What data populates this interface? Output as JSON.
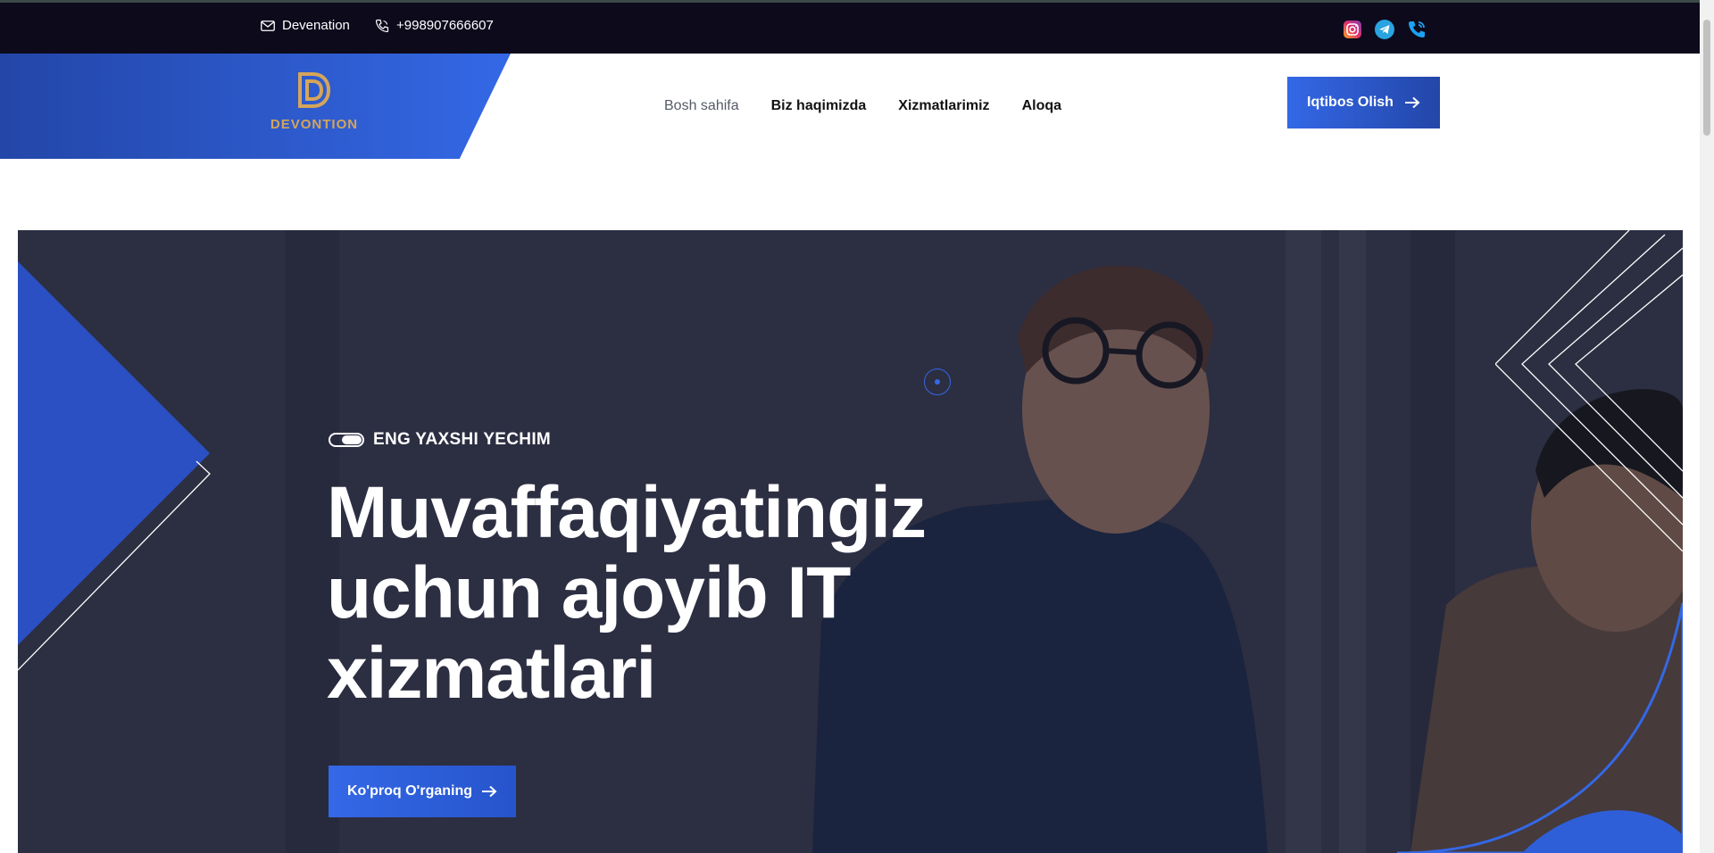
{
  "topbar": {
    "email_label": "Devenation",
    "phone_label": "+998907666607",
    "socials": [
      "instagram-icon",
      "telegram-icon",
      "phone-call-icon"
    ]
  },
  "header": {
    "logo_text": "DEVONTION",
    "nav": [
      {
        "label": "Bosh sahifa",
        "active": true
      },
      {
        "label": "Biz haqimizda",
        "active": false
      },
      {
        "label": "Xizmatlarimiz",
        "active": false
      },
      {
        "label": "Aloqa",
        "active": false
      }
    ],
    "cta_label": "Iqtibos Olish"
  },
  "hero": {
    "eyebrow": "ENG YAXSHI YECHIM",
    "title_line1": "Muvaffaqiyatingiz",
    "title_line2": "uchun ajoyib IT",
    "title_line3": "xizmatlari",
    "button_label": "Ko'proq O'rganing"
  },
  "colors": {
    "accent": "#3468e6",
    "accent_dark": "#2346a8",
    "logo_gold": "#d4a55a",
    "topbar_bg": "#0d0a1c"
  }
}
